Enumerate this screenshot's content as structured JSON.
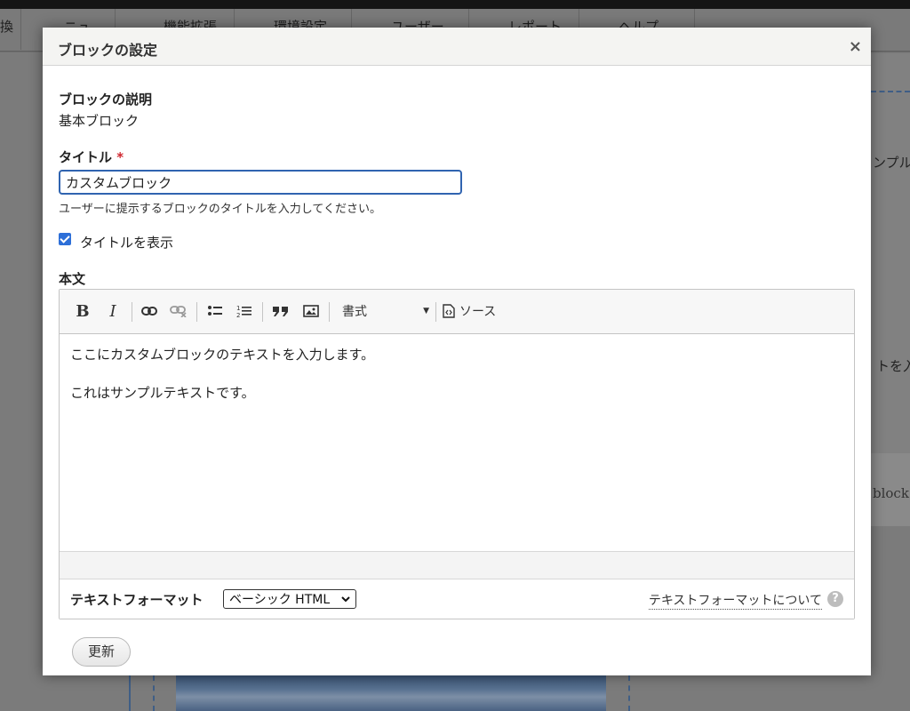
{
  "background": {
    "toolbar_items": [
      "換",
      "ニュ",
      "機能拡張",
      "環境設定",
      "ユーザー",
      "レポート",
      "ヘルプ"
    ],
    "side_texts": [
      "ンプル",
      "トを入",
      "block"
    ]
  },
  "dialog": {
    "title": "ブロックの設定",
    "close_glyph": "×"
  },
  "block_description": {
    "label": "ブロックの説明",
    "value": "基本ブロック"
  },
  "title_field": {
    "label": "タイトル",
    "required_mark": "*",
    "value": "カスタムブロック",
    "description": "ユーザーに提示するブロックのタイトルを入力してください。"
  },
  "display_title": {
    "label": "タイトルを表示",
    "checked": true
  },
  "body": {
    "label": "本文",
    "toolbar": {
      "bold": "B",
      "italic": "I",
      "format_label": "書式",
      "source_label": "ソース",
      "icons": [
        "bold-icon",
        "italic-icon",
        "link-icon",
        "unlink-icon",
        "bulleted-list-icon",
        "numbered-list-icon",
        "blockquote-icon",
        "image-icon",
        "dropdown-arrow-icon",
        "source-icon"
      ]
    },
    "paragraphs": [
      "ここにカスタムブロックのテキストを入力します。",
      "これはサンプルテキストです。"
    ]
  },
  "text_format": {
    "label": "テキストフォーマット",
    "selected": "ベーシック HTML",
    "about_link": "テキストフォーマットについて",
    "help_glyph": "?"
  },
  "actions": {
    "update_label": "更新"
  },
  "colors": {
    "accent": "#2d6fd8",
    "focus_border": "#3064b0",
    "required": "#d0272f"
  }
}
